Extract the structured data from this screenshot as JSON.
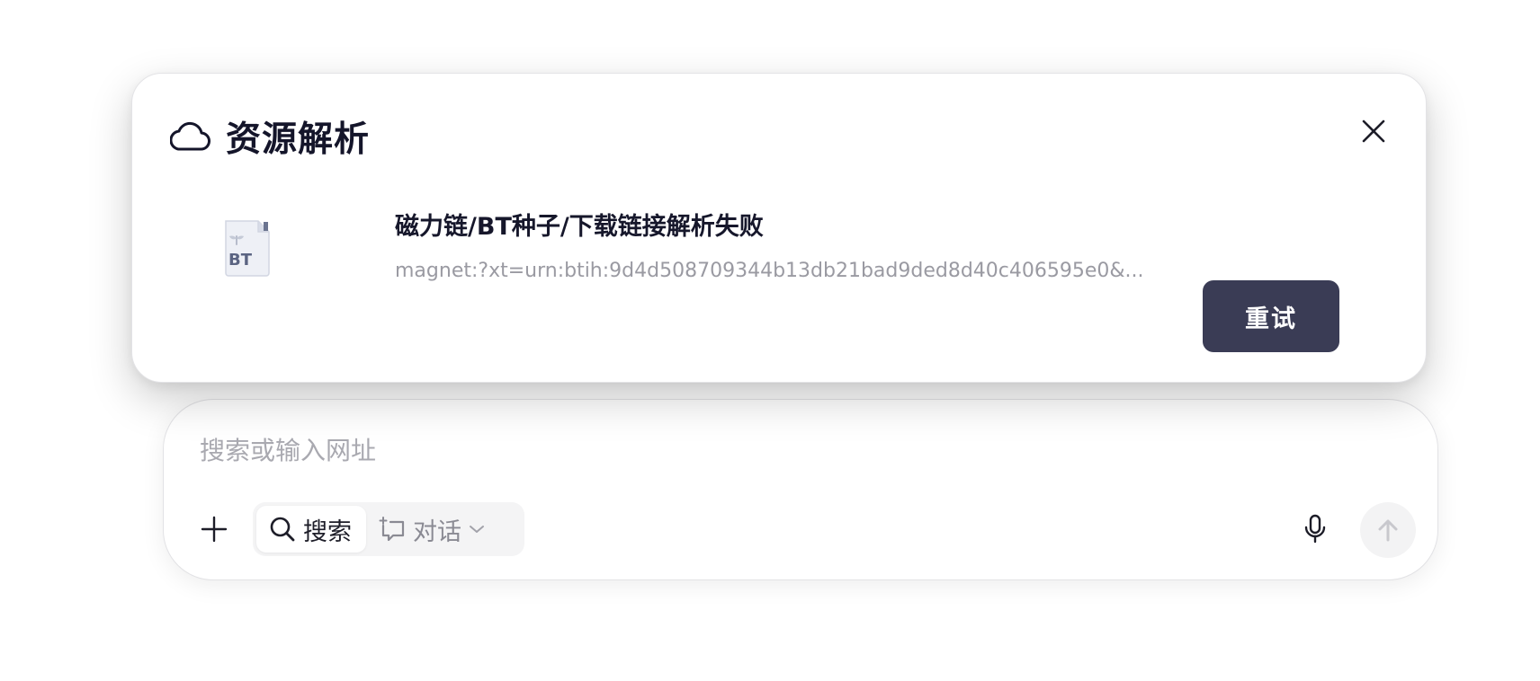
{
  "panel": {
    "title": "资源解析",
    "icon": "cloud-icon",
    "close_icon": "close-icon",
    "file": {
      "icon": "bt-file-icon",
      "icon_badge": "BT",
      "title": "磁力链/BT种子/下载链接解析失败",
      "link": "magnet:?xt=urn:btih:9d4d508709344b13db21bad9ded8d40c406595e0&...",
      "retry_label": "重试"
    }
  },
  "search_box": {
    "placeholder": "搜索或输入网址",
    "modes": [
      {
        "label": "搜索",
        "icon": "search-icon",
        "selected": true
      },
      {
        "label": "对话",
        "icon": "chat-icon",
        "selected": false
      }
    ],
    "icons": {
      "add": "plus-icon",
      "mic": "microphone-icon",
      "send": "arrow-up-icon",
      "dropdown": "chevron-down-icon"
    }
  },
  "colors": {
    "title_text": "#14152a",
    "retry_bg": "#3a3c55",
    "muted_text": "#9a9aa2",
    "placeholder": "#a9a9b0"
  }
}
